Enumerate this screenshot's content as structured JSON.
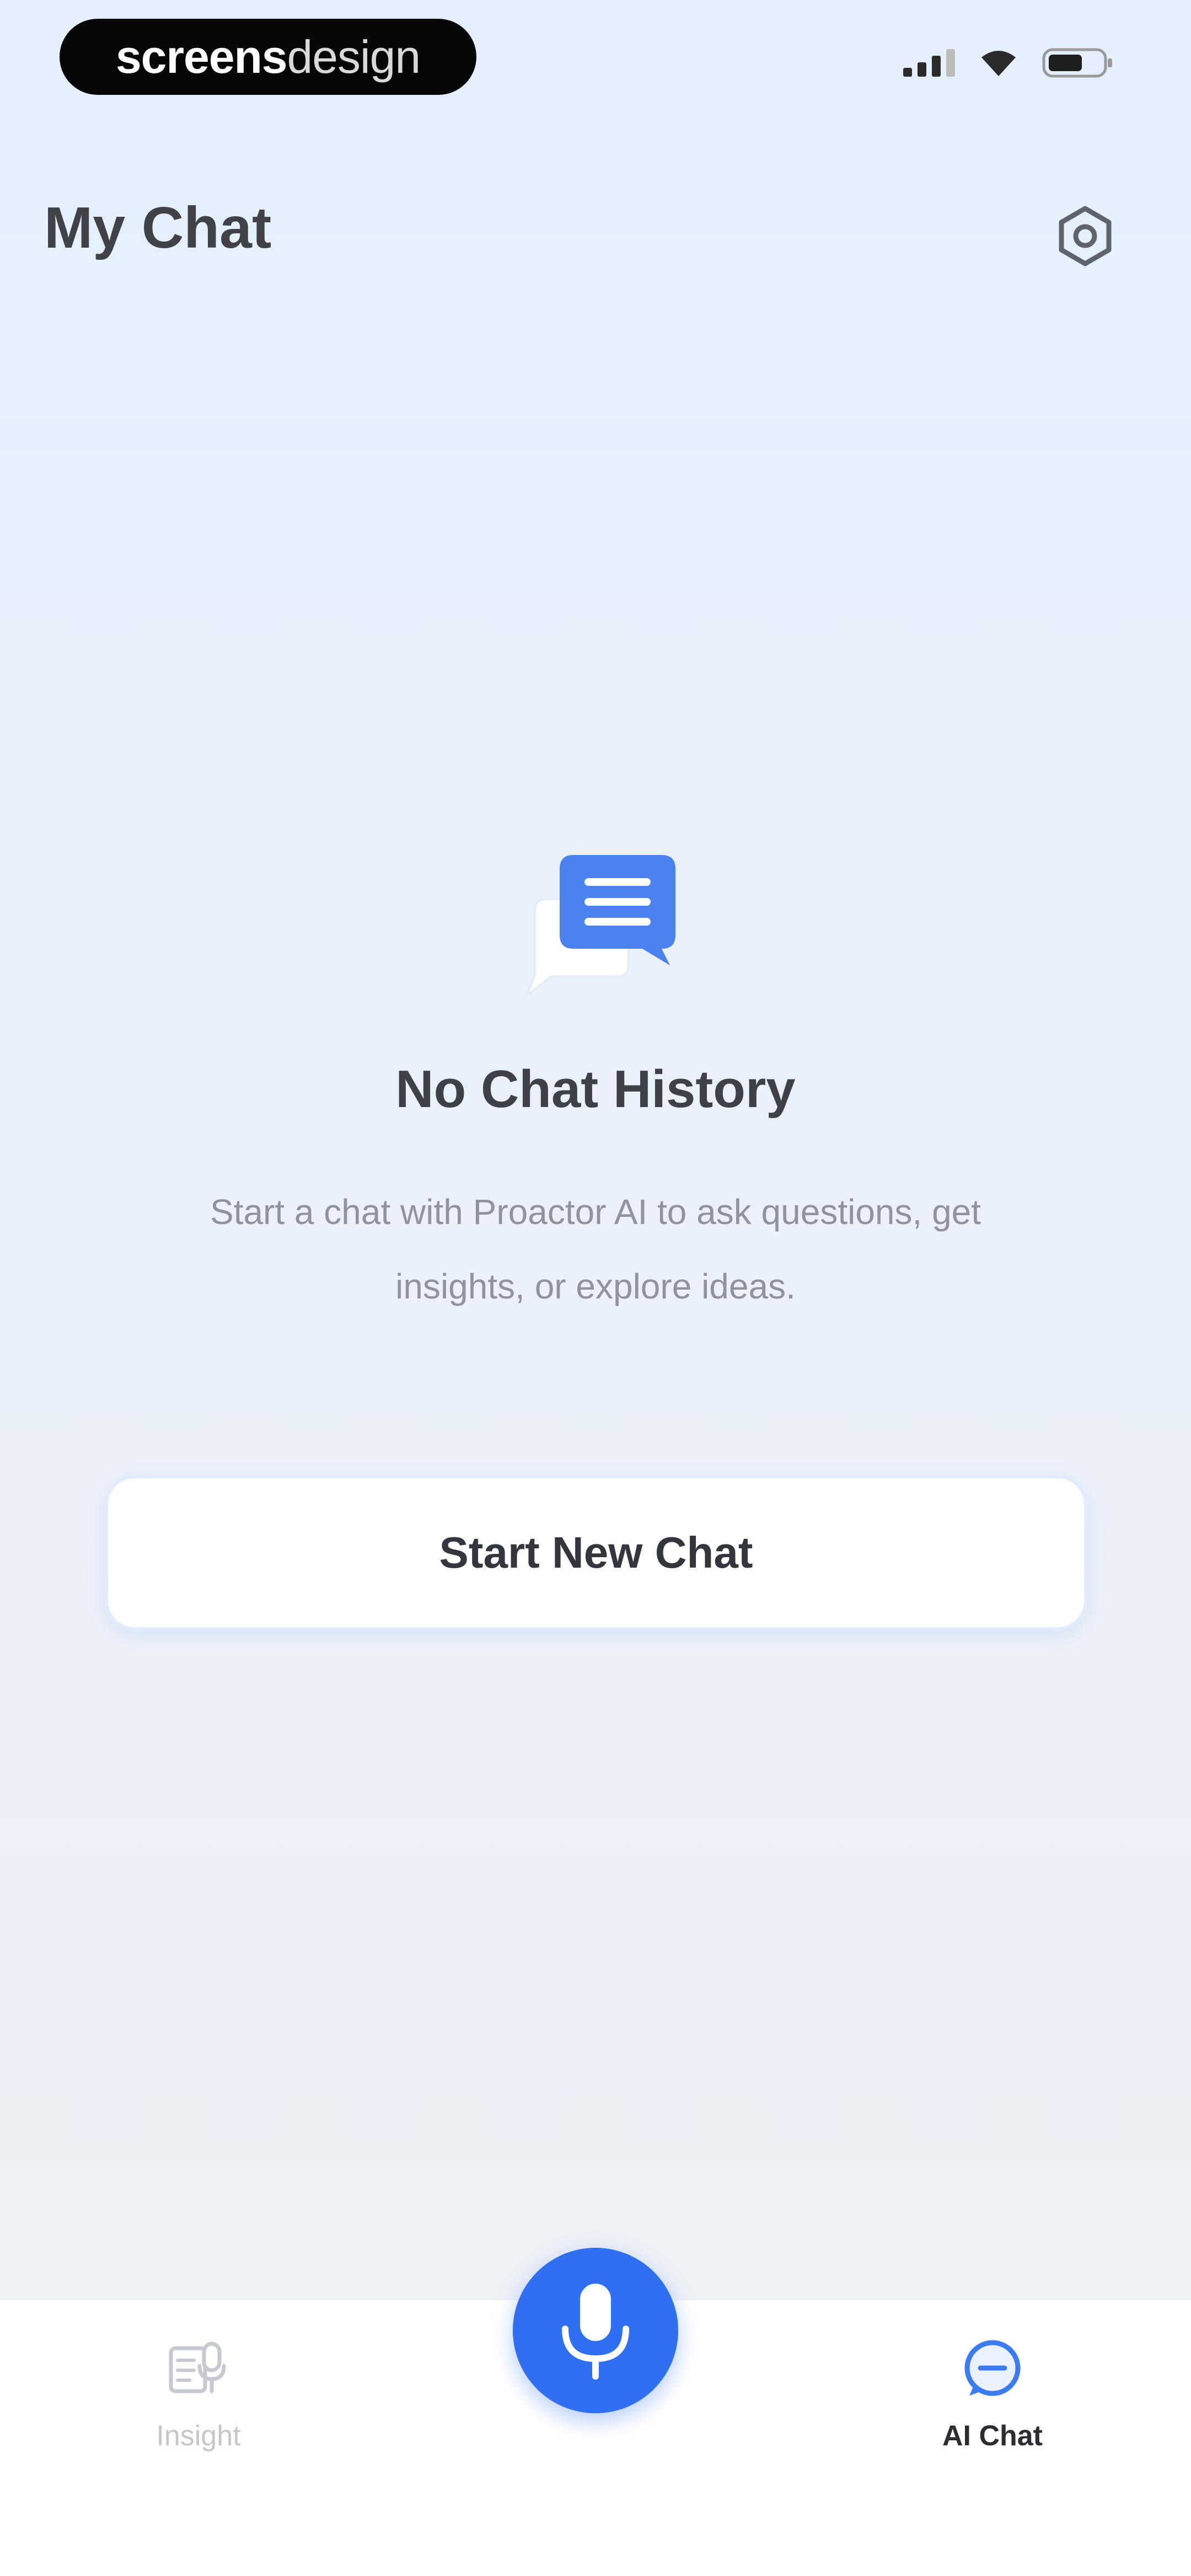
{
  "status_bar": {
    "brand_bold": "screens",
    "brand_light": "design"
  },
  "header": {
    "title": "My Chat",
    "settings_icon": "gear-icon"
  },
  "empty_state": {
    "icon": "chat-bubbles-icon",
    "title": "No Chat History",
    "description": "Start a chat with Proactor AI to ask questions, get insights, or explore ideas."
  },
  "actions": {
    "start_new_chat_label": "Start New Chat"
  },
  "bottom_nav": {
    "items": [
      {
        "label": "Insight",
        "icon": "insight-icon",
        "active": false
      },
      {
        "label": "AI Chat",
        "icon": "chat-icon",
        "active": true
      }
    ],
    "center_button_icon": "microphone-icon"
  },
  "colors": {
    "accent": "#2f6ff2",
    "title_text": "#404248",
    "muted_text": "#8f949c",
    "background_top": "#e4efff",
    "background_bottom": "#eef1f6"
  }
}
